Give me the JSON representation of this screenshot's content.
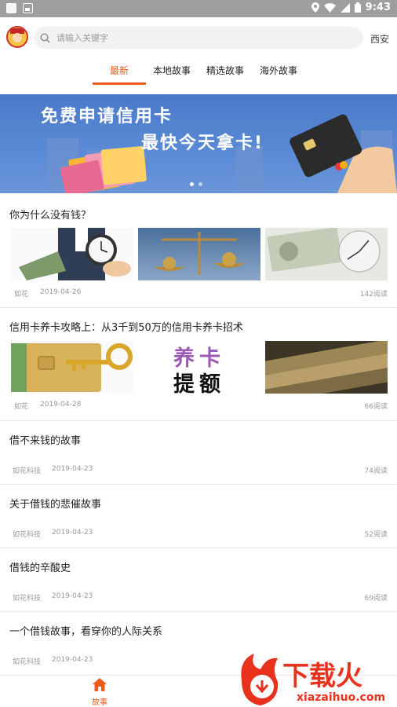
{
  "status_bar": {
    "time": "9:43"
  },
  "header": {
    "search_placeholder": "请输入关键字",
    "city": "西安"
  },
  "tabs": [
    {
      "label": "最新",
      "active": true
    },
    {
      "label": "本地故事",
      "active": false
    },
    {
      "label": "精选故事",
      "active": false
    },
    {
      "label": "海外故事",
      "active": false
    }
  ],
  "banner": {
    "line1": "免费申请信用卡",
    "line2": "最快今天拿卡!",
    "page_count": 2,
    "current_page": 1
  },
  "articles": [
    {
      "title": "你为什么没有钱？",
      "author": "如花",
      "date": "2019-04-26",
      "reads": "142阅读"
    },
    {
      "title": "信用卡养卡攻略上：从3千到50万的信用卡养卡招术",
      "author": "如花",
      "date": "2019-04-28",
      "reads": "66阅读",
      "thumb2_text_top": "养卡",
      "thumb2_text_bottom": "提额"
    },
    {
      "title": "借不来钱的故事",
      "author": "如花科技",
      "date": "2019-04-23",
      "reads": "74阅读"
    },
    {
      "title": "关于借钱的悲催故事",
      "author": "如花科技",
      "date": "2019-04-23",
      "reads": "52阅读"
    },
    {
      "title": "借钱的辛酸史",
      "author": "如花科技",
      "date": "2019-04-23",
      "reads": "69阅读"
    },
    {
      "title": "一个借钱故事，看穿你的人际关系",
      "author": "如花科技",
      "date": "2019-04-23",
      "reads": ""
    }
  ],
  "bottom_nav": {
    "story_label": "故事"
  },
  "watermark": {
    "brand": "下载火",
    "url": "xiazaihuo.com"
  },
  "colors": {
    "accent": "#f05a1a",
    "banner": "#5b8bd6"
  }
}
